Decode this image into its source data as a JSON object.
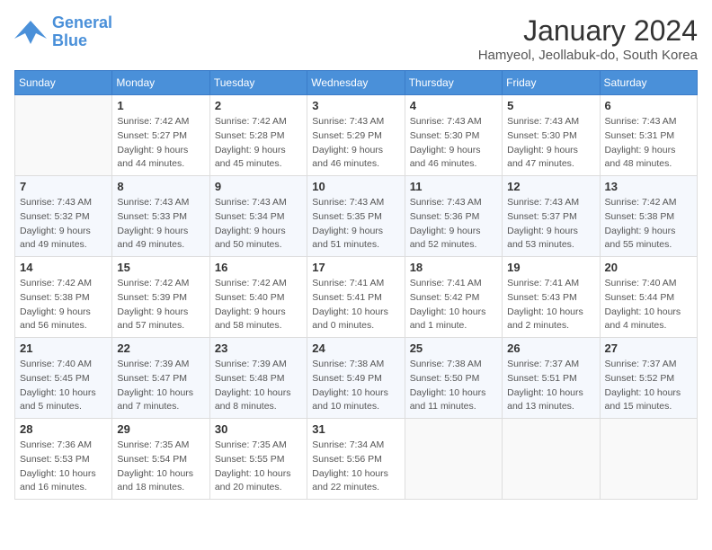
{
  "logo": {
    "line1": "General",
    "line2": "Blue"
  },
  "title": "January 2024",
  "location": "Hamyeol, Jeollabuk-do, South Korea",
  "days_of_week": [
    "Sunday",
    "Monday",
    "Tuesday",
    "Wednesday",
    "Thursday",
    "Friday",
    "Saturday"
  ],
  "weeks": [
    [
      {
        "day": "",
        "info": ""
      },
      {
        "day": "1",
        "info": "Sunrise: 7:42 AM\nSunset: 5:27 PM\nDaylight: 9 hours\nand 44 minutes."
      },
      {
        "day": "2",
        "info": "Sunrise: 7:42 AM\nSunset: 5:28 PM\nDaylight: 9 hours\nand 45 minutes."
      },
      {
        "day": "3",
        "info": "Sunrise: 7:43 AM\nSunset: 5:29 PM\nDaylight: 9 hours\nand 46 minutes."
      },
      {
        "day": "4",
        "info": "Sunrise: 7:43 AM\nSunset: 5:30 PM\nDaylight: 9 hours\nand 46 minutes."
      },
      {
        "day": "5",
        "info": "Sunrise: 7:43 AM\nSunset: 5:30 PM\nDaylight: 9 hours\nand 47 minutes."
      },
      {
        "day": "6",
        "info": "Sunrise: 7:43 AM\nSunset: 5:31 PM\nDaylight: 9 hours\nand 48 minutes."
      }
    ],
    [
      {
        "day": "7",
        "info": "Sunrise: 7:43 AM\nSunset: 5:32 PM\nDaylight: 9 hours\nand 49 minutes."
      },
      {
        "day": "8",
        "info": "Sunrise: 7:43 AM\nSunset: 5:33 PM\nDaylight: 9 hours\nand 49 minutes."
      },
      {
        "day": "9",
        "info": "Sunrise: 7:43 AM\nSunset: 5:34 PM\nDaylight: 9 hours\nand 50 minutes."
      },
      {
        "day": "10",
        "info": "Sunrise: 7:43 AM\nSunset: 5:35 PM\nDaylight: 9 hours\nand 51 minutes."
      },
      {
        "day": "11",
        "info": "Sunrise: 7:43 AM\nSunset: 5:36 PM\nDaylight: 9 hours\nand 52 minutes."
      },
      {
        "day": "12",
        "info": "Sunrise: 7:43 AM\nSunset: 5:37 PM\nDaylight: 9 hours\nand 53 minutes."
      },
      {
        "day": "13",
        "info": "Sunrise: 7:42 AM\nSunset: 5:38 PM\nDaylight: 9 hours\nand 55 minutes."
      }
    ],
    [
      {
        "day": "14",
        "info": "Sunrise: 7:42 AM\nSunset: 5:38 PM\nDaylight: 9 hours\nand 56 minutes."
      },
      {
        "day": "15",
        "info": "Sunrise: 7:42 AM\nSunset: 5:39 PM\nDaylight: 9 hours\nand 57 minutes."
      },
      {
        "day": "16",
        "info": "Sunrise: 7:42 AM\nSunset: 5:40 PM\nDaylight: 9 hours\nand 58 minutes."
      },
      {
        "day": "17",
        "info": "Sunrise: 7:41 AM\nSunset: 5:41 PM\nDaylight: 10 hours\nand 0 minutes."
      },
      {
        "day": "18",
        "info": "Sunrise: 7:41 AM\nSunset: 5:42 PM\nDaylight: 10 hours\nand 1 minute."
      },
      {
        "day": "19",
        "info": "Sunrise: 7:41 AM\nSunset: 5:43 PM\nDaylight: 10 hours\nand 2 minutes."
      },
      {
        "day": "20",
        "info": "Sunrise: 7:40 AM\nSunset: 5:44 PM\nDaylight: 10 hours\nand 4 minutes."
      }
    ],
    [
      {
        "day": "21",
        "info": "Sunrise: 7:40 AM\nSunset: 5:45 PM\nDaylight: 10 hours\nand 5 minutes."
      },
      {
        "day": "22",
        "info": "Sunrise: 7:39 AM\nSunset: 5:47 PM\nDaylight: 10 hours\nand 7 minutes."
      },
      {
        "day": "23",
        "info": "Sunrise: 7:39 AM\nSunset: 5:48 PM\nDaylight: 10 hours\nand 8 minutes."
      },
      {
        "day": "24",
        "info": "Sunrise: 7:38 AM\nSunset: 5:49 PM\nDaylight: 10 hours\nand 10 minutes."
      },
      {
        "day": "25",
        "info": "Sunrise: 7:38 AM\nSunset: 5:50 PM\nDaylight: 10 hours\nand 11 minutes."
      },
      {
        "day": "26",
        "info": "Sunrise: 7:37 AM\nSunset: 5:51 PM\nDaylight: 10 hours\nand 13 minutes."
      },
      {
        "day": "27",
        "info": "Sunrise: 7:37 AM\nSunset: 5:52 PM\nDaylight: 10 hours\nand 15 minutes."
      }
    ],
    [
      {
        "day": "28",
        "info": "Sunrise: 7:36 AM\nSunset: 5:53 PM\nDaylight: 10 hours\nand 16 minutes."
      },
      {
        "day": "29",
        "info": "Sunrise: 7:35 AM\nSunset: 5:54 PM\nDaylight: 10 hours\nand 18 minutes."
      },
      {
        "day": "30",
        "info": "Sunrise: 7:35 AM\nSunset: 5:55 PM\nDaylight: 10 hours\nand 20 minutes."
      },
      {
        "day": "31",
        "info": "Sunrise: 7:34 AM\nSunset: 5:56 PM\nDaylight: 10 hours\nand 22 minutes."
      },
      {
        "day": "",
        "info": ""
      },
      {
        "day": "",
        "info": ""
      },
      {
        "day": "",
        "info": ""
      }
    ]
  ]
}
